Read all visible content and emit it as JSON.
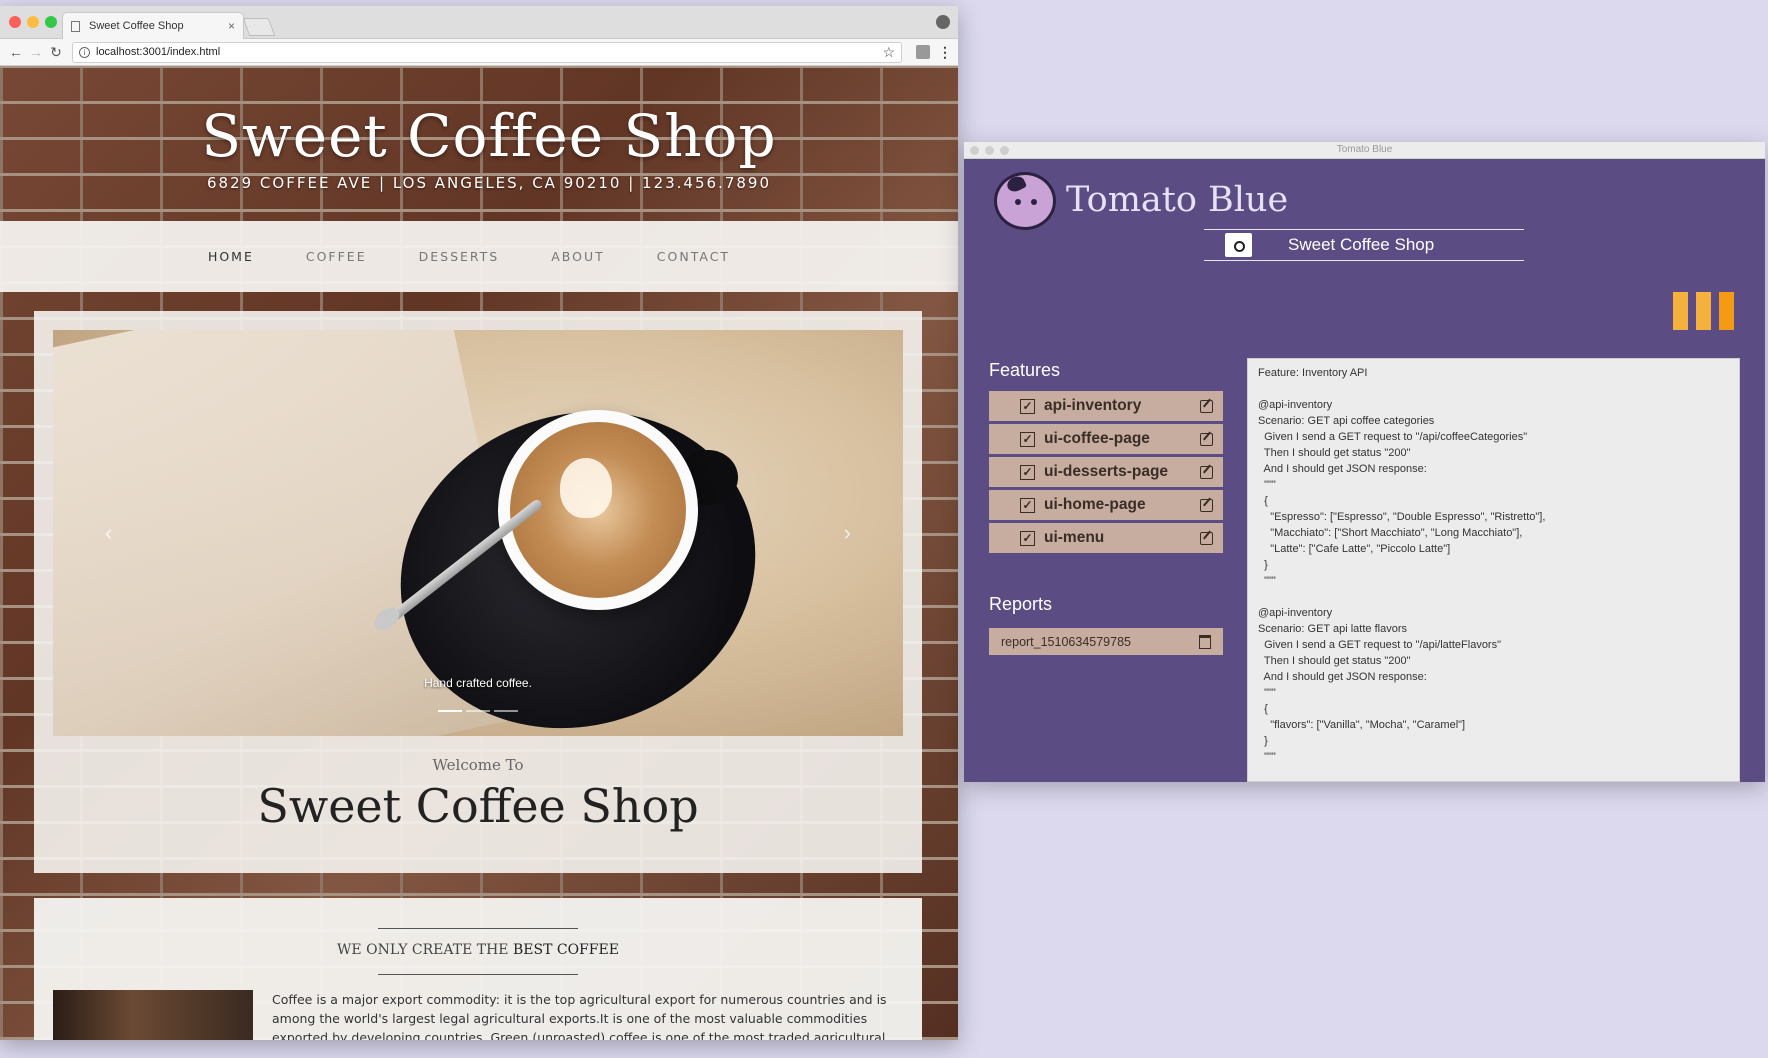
{
  "browser": {
    "tab_title": "Sweet Coffee Shop",
    "tab_close": "×",
    "url": "localhost:3001/index.html",
    "icons": [
      "back-arrow-icon",
      "forward-arrow-icon",
      "reload-icon",
      "info-icon",
      "star-icon",
      "extension-icon",
      "menu-dots-icon",
      "profile-icon"
    ]
  },
  "site": {
    "title": "Sweet Coffee Shop",
    "address": "6829 COFFEE AVE | LOS ANGELES, CA 90210 | 123.456.7890",
    "nav": [
      "HOME",
      "COFFEE",
      "DESSERTS",
      "ABOUT",
      "CONTACT"
    ],
    "carousel": {
      "caption": "Hand crafted coffee.",
      "prev": "‹",
      "next": "›",
      "slide_count": 3,
      "active_slide": 1
    },
    "welcome_pre": "Welcome To",
    "welcome_title": "Sweet Coffee Shop",
    "tagline_prefix": "WE ONLY CREATE THE ",
    "tagline_bold": "BEST COFFEE",
    "body_text": "Coffee is a major export commodity: it is the top agricultural export for numerous countries and is among the world's largest legal agricultural exports.It is one of the most valuable commodities exported by developing countries. Green (unroasted) coffee is one of the most traded agricultural commodities in the"
  },
  "tomato": {
    "window_title": "Tomato Blue",
    "app_title": "Tomato Blue",
    "project_name": "Sweet Coffee Shop",
    "features_heading": "Features",
    "features": [
      {
        "label": "api-inventory",
        "checked": true
      },
      {
        "label": "ui-coffee-page",
        "checked": true
      },
      {
        "label": "ui-desserts-page",
        "checked": true
      },
      {
        "label": "ui-home-page",
        "checked": true
      },
      {
        "label": "ui-menu",
        "checked": true
      }
    ],
    "check_glyph": "✓",
    "reports_heading": "Reports",
    "reports": [
      "report_1510634579785"
    ],
    "code": "Feature: Inventory API\n\n@api-inventory\nScenario: GET api coffee categories\n  Given I send a GET request to \"/api/coffeeCategories\"\n  Then I should get status \"200\"\n  And I should get JSON response:\n  \"\"\"\n  {\n    \"Espresso\": [\"Espresso\", \"Double Espresso\", \"Ristretto\"],\n    \"Macchiato\": [\"Short Macchiato\", \"Long Macchiato\"],\n    \"Latte\": [\"Cafe Latte\", \"Piccolo Latte\"]\n  }\n  \"\"\"\n\n@api-inventory\nScenario: GET api latte flavors\n  Given I send a GET request to \"/api/latteFlavors\"\n  Then I should get status \"200\"\n  And I should get JSON response:\n  \"\"\"\n  {\n    \"flavors\": [\"Vanilla\", \"Mocha\", \"Caramel\"]\n  }\n  \"\"\"",
    "colors": {
      "background": "#5b4d84",
      "item": "#c7ada0",
      "accent": "#f5b13d"
    }
  }
}
